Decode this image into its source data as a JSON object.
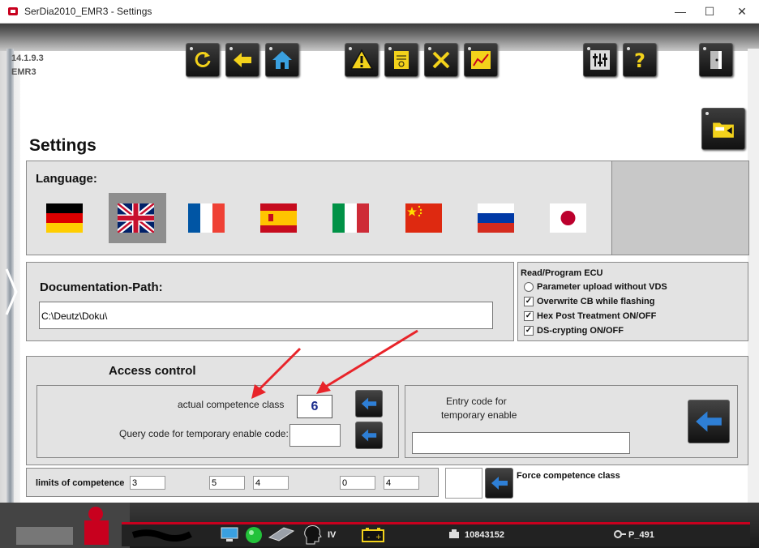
{
  "window": {
    "title": "SerDia2010_EMR3 - Settings",
    "minimize": "—",
    "maximize": "☐",
    "close": "✕"
  },
  "version": {
    "number": "14.1.9.3",
    "ecu": "EMR3"
  },
  "toolbar": {
    "buttons": [
      "refresh-icon",
      "back-arrow-icon",
      "home-icon",
      "warning-icon",
      "document-icon",
      "tools-icon",
      "chart-icon",
      "sliders-icon",
      "help-icon",
      "exit-door-icon"
    ]
  },
  "page": {
    "title": "Settings"
  },
  "language": {
    "label": "Language:",
    "flags": [
      "Germany",
      "United Kingdom",
      "France",
      "Spain",
      "Italy",
      "China",
      "Russia",
      "Japan"
    ],
    "selected": "United Kingdom"
  },
  "documentation": {
    "label": "Documentation-Path:",
    "path": "C:\\Deutz\\Doku\\"
  },
  "ecu": {
    "title": "Read/Program ECU",
    "options": [
      {
        "label": "Parameter upload without VDS",
        "type": "radio",
        "checked": false
      },
      {
        "label": "Overwrite CB while flashing",
        "type": "checkbox",
        "checked": true
      },
      {
        "label": "Hex Post Treatment ON/OFF",
        "type": "checkbox",
        "checked": true
      },
      {
        "label": "DS-crypting ON/OFF",
        "type": "checkbox",
        "checked": true
      }
    ]
  },
  "access": {
    "label": "Access control",
    "competence_label": "actual competence class",
    "competence_value": "6",
    "query_label": "Query code for temporary enable code:",
    "entry_label_1": "Entry code for",
    "entry_label_2": "temporary enable"
  },
  "limits": {
    "label": "limits of competence",
    "values": [
      "3",
      "5",
      "4",
      "0",
      "4"
    ],
    "force_label": "Force competence class"
  },
  "status": {
    "level": "IV",
    "serial": "10843152",
    "program": "P_491"
  },
  "colors": {
    "accent_red": "#c8001e",
    "panel": "#e3e3e3",
    "button_dark": "#1a1a1a",
    "arrow_blue": "#2e7fd6",
    "annotation_red": "#e8242a"
  }
}
